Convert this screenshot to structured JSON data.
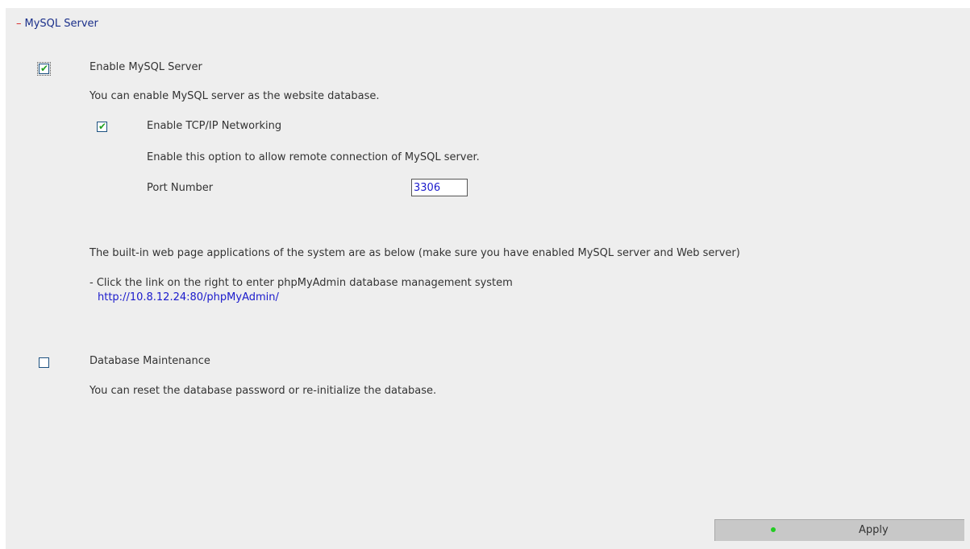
{
  "section": {
    "collapse_symbol": "–",
    "title": "MySQL Server"
  },
  "enable_mysql": {
    "checked": true,
    "label": "Enable MySQL Server",
    "description": "You can enable MySQL server as the website database."
  },
  "tcp_ip": {
    "checked": true,
    "label": "Enable TCP/IP Networking",
    "description": "Enable this option to allow remote connection of MySQL server.",
    "port_label": "Port Number",
    "port_value": "3306"
  },
  "builtin_apps": {
    "description": "The built-in web page applications of the system are as below (make sure you have enabled MySQL server and Web server)",
    "phpmyadmin_note": "- Click the link on the right to enter phpMyAdmin database management system",
    "phpmyadmin_link": "http://10.8.12.24:80/phpMyAdmin/"
  },
  "db_maintenance": {
    "checked": false,
    "label": "Database Maintenance",
    "description": "You can reset the database password or re-initialize the database."
  },
  "apply_button": {
    "label": "Apply",
    "status_color": "#22cc22"
  },
  "colors": {
    "panel_bg": "#eeeeee",
    "header_text": "#1a2f8a",
    "collapse_symbol": "#d62a2a",
    "link": "#1a1acc",
    "checkmark": "#21a121"
  }
}
